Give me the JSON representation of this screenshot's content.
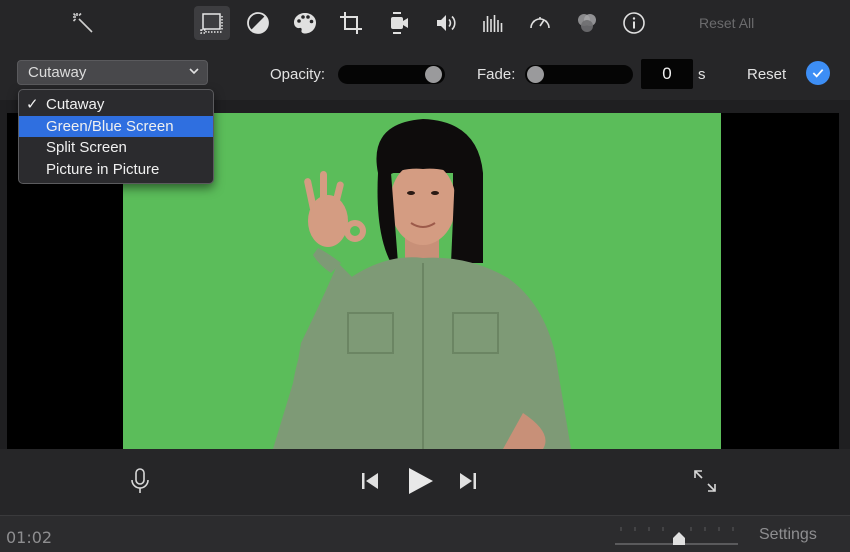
{
  "toolbar": {
    "icons": [
      {
        "name": "magic-wand-icon"
      },
      {
        "name": "video-overlay-icon",
        "active": true
      },
      {
        "name": "color-balance-icon"
      },
      {
        "name": "color-palette-icon"
      },
      {
        "name": "crop-icon"
      },
      {
        "name": "stabilization-camera-icon"
      },
      {
        "name": "volume-icon"
      },
      {
        "name": "equalizer-icon"
      },
      {
        "name": "speed-icon"
      },
      {
        "name": "filter-icon"
      },
      {
        "name": "info-icon"
      }
    ],
    "reset_all_label": "Reset All"
  },
  "overlay_controls": {
    "style_selected": "Cutaway",
    "opacity_label": "Opacity:",
    "opacity_value": 1.0,
    "fade_label": "Fade:",
    "fade_value": "0",
    "fade_unit": "s",
    "reset_label": "Reset"
  },
  "style_menu": {
    "items": [
      {
        "label": "Cutaway",
        "checked": true
      },
      {
        "label": "Green/Blue Screen",
        "highlighted": true
      },
      {
        "label": "Split Screen"
      },
      {
        "label": "Picture in Picture"
      }
    ],
    "check_mark": "✓"
  },
  "viewer": {
    "background_color": "#5bbd5a"
  },
  "transport": {
    "icons": [
      "microphone-icon",
      "skip-back-icon",
      "play-icon",
      "skip-forward-icon",
      "fullscreen-icon"
    ]
  },
  "bottom_bar": {
    "timecode": "01:02",
    "settings_label": "Settings"
  },
  "colors": {
    "accent": "#3d8ef5",
    "menu_highlight": "#2f6fe0"
  }
}
